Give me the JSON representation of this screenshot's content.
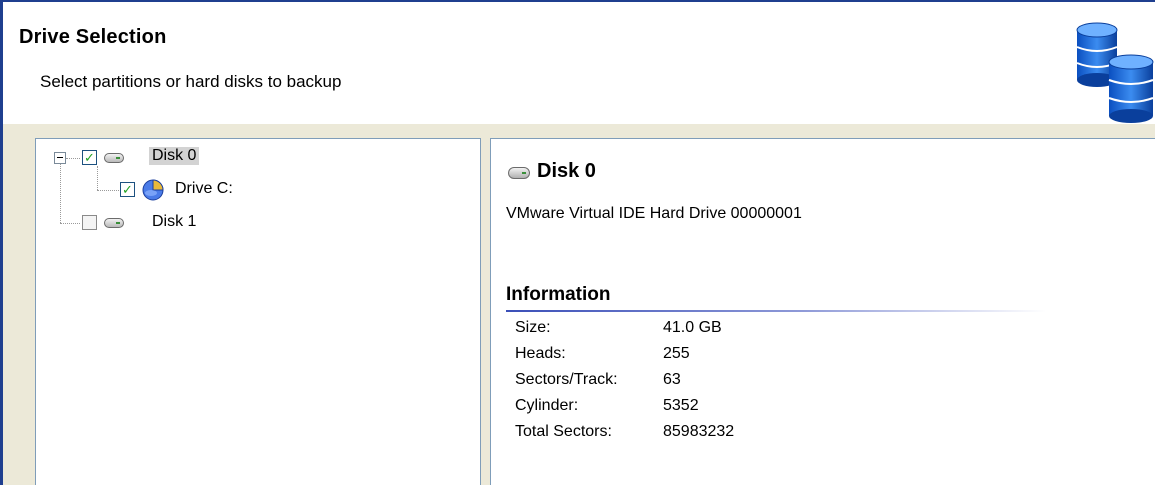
{
  "header": {
    "title": "Drive Selection",
    "subtitle": "Select partitions or hard disks to backup",
    "icon": "database-icon"
  },
  "tree": {
    "items": [
      {
        "label": "Disk 0",
        "checked": true,
        "icon": "hard-disk-icon",
        "selected": true,
        "expanded": true
      },
      {
        "label": "Drive C:",
        "checked": true,
        "icon": "partition-icon"
      },
      {
        "label": "Disk 1",
        "checked": false,
        "icon": "hard-disk-icon"
      }
    ]
  },
  "details": {
    "title": "Disk 0",
    "description": "VMware Virtual IDE Hard Drive 00000001",
    "section_title": "Information",
    "info": [
      {
        "label": "Size:",
        "value": "41.0 GB"
      },
      {
        "label": "Heads:",
        "value": "255"
      },
      {
        "label": "Sectors/Track:",
        "value": "63"
      },
      {
        "label": "Cylinder:",
        "value": "5352"
      },
      {
        "label": "Total Sectors:",
        "value": "85983232"
      }
    ]
  },
  "colors": {
    "frame": "#1f3f8f",
    "panel_border": "#7f9db9",
    "body_background": "#ece9d8",
    "selection": "#d3d3d3",
    "check": "#21a121"
  }
}
